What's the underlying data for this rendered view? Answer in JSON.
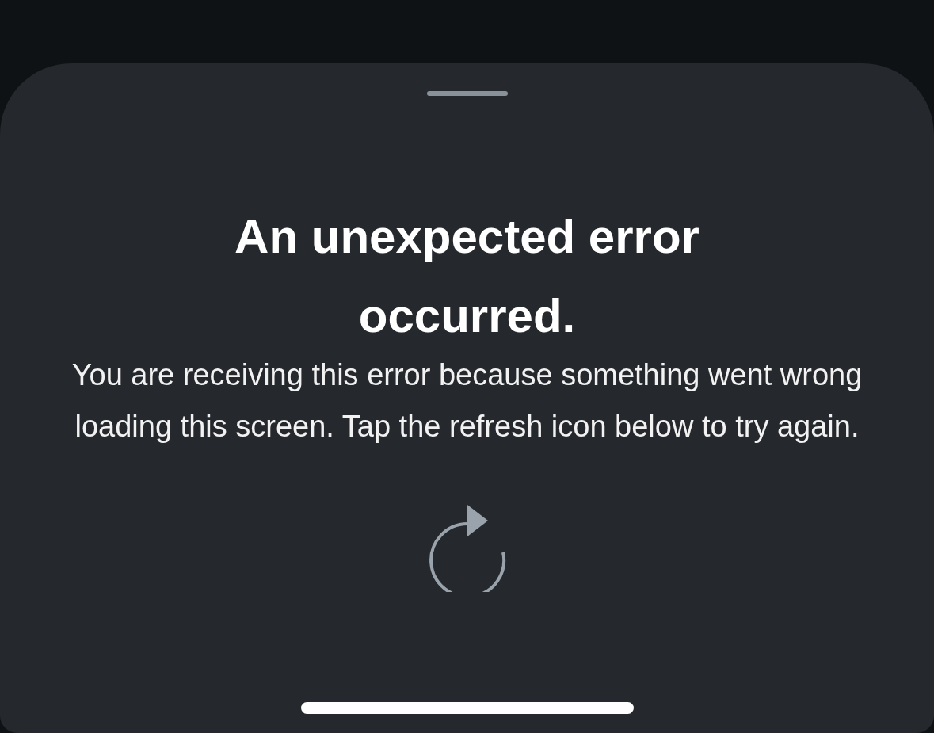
{
  "error": {
    "title": "An unexpected error occurred.",
    "message": "You are receiving this error because something went wrong loading this screen. Tap the refresh icon below to try again."
  }
}
